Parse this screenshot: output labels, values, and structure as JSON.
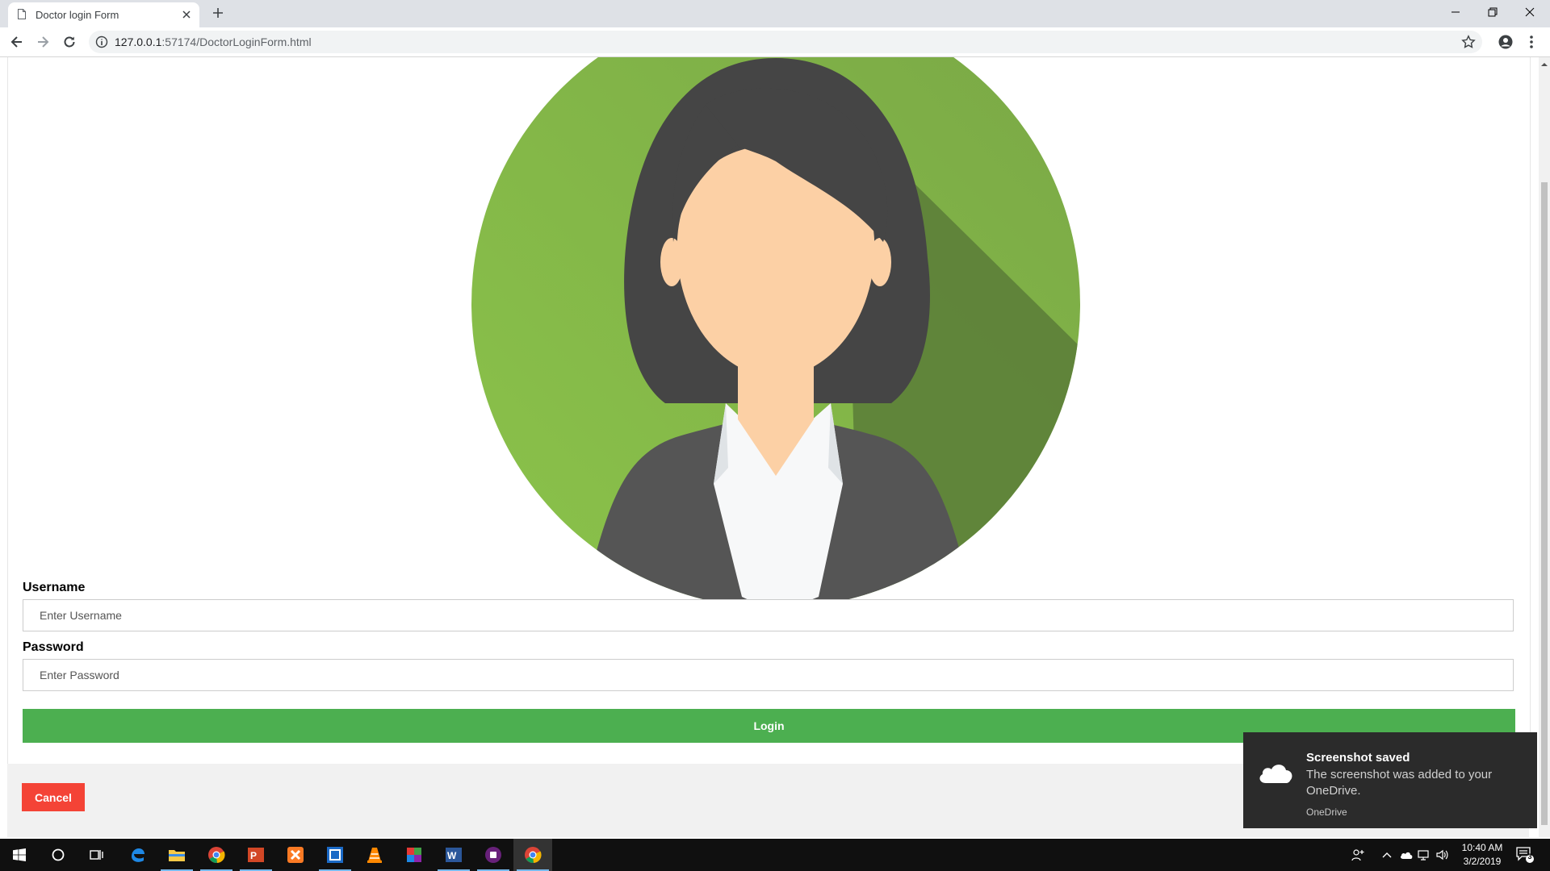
{
  "browser": {
    "tab_title": "Doctor login Form",
    "url_host": "127.0.0.1",
    "url_rest": ":57174/DoctorLoginForm.html"
  },
  "form": {
    "username_label": "Username",
    "username_placeholder": "Enter Username",
    "password_label": "Password",
    "password_placeholder": "Enter Password",
    "login_label": "Login",
    "cancel_label": "Cancel"
  },
  "toast": {
    "title": "Screenshot saved",
    "body": "The screenshot was added to your OneDrive.",
    "app": "OneDrive"
  },
  "taskbar": {
    "time": "10:40 AM",
    "date": "3/2/2019",
    "notification_count": "3",
    "apps": [
      "start-icon",
      "cortana-icon",
      "task-view-icon",
      "edge-icon",
      "file-explorer-icon",
      "chrome-icon",
      "powerpoint-icon",
      "xampp-icon",
      "netbeans-icon",
      "vlc-icon",
      "winrar-icon",
      "word-icon",
      "visual-studio-icon",
      "chrome-icon"
    ]
  },
  "colors": {
    "login_button": "#4caf50",
    "cancel_button": "#f44336",
    "avatar_circle": "#8bc34a",
    "hair": "#454545",
    "skin": "#fcd0a5",
    "jacket": "#555555",
    "shirt": "#f7f8f9"
  }
}
